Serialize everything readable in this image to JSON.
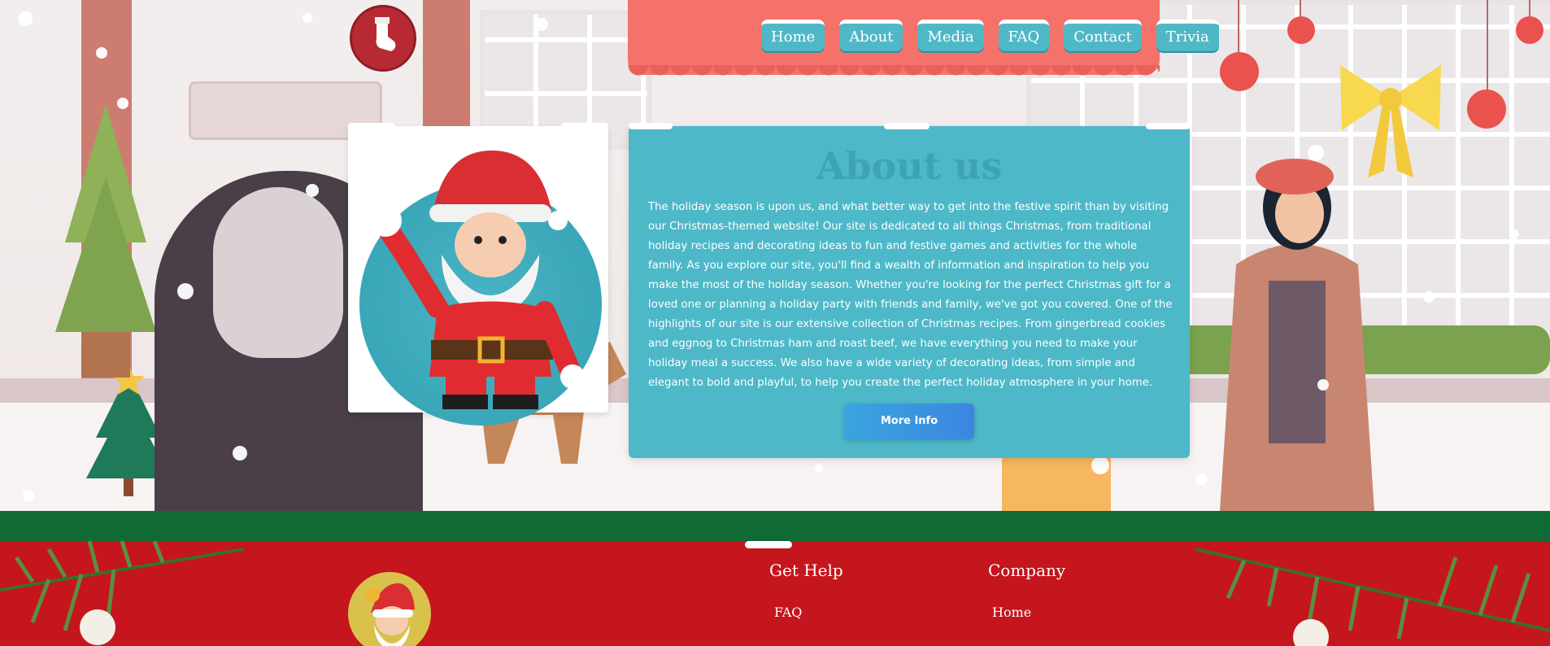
{
  "nav": {
    "items": [
      "Home",
      "About",
      "Media",
      "FAQ",
      "Contact",
      "Trivia"
    ]
  },
  "about": {
    "title": "About us",
    "body": "The holiday season is upon us, and what better way to get into the festive spirit than by visiting our Christmas-themed website! Our site is dedicated to all things Christmas, from traditional holiday recipes and decorating ideas to fun and festive games and activities for the whole family. As you explore our site, you'll find a wealth of information and inspiration to help you make the most of the holiday season. Whether you're looking for the perfect Christmas gift for a loved one or planning a holiday party with friends and family, we've got you covered. One of the highlights of our site is our extensive collection of Christmas recipes. From gingerbread cookies and eggnog to Christmas ham and roast beef, we have everything you need to make your holiday meal a success. We also have a wide variety of decorating ideas, from simple and elegant to bold and playful, to help you create the perfect holiday atmosphere in your home.",
    "button": "More Info"
  },
  "footer": {
    "get_help": {
      "heading": "Get Help",
      "links": [
        "FAQ"
      ]
    },
    "company": {
      "heading": "Company",
      "links": [
        "Home"
      ]
    }
  },
  "icons": {
    "stocking": "stocking-icon",
    "santa": "santa-illustration",
    "footer_logo": "santa-logo"
  },
  "colors": {
    "accent_teal": "#4db8c8",
    "button_blue": "#3a96df",
    "footer_red": "#c5151d",
    "footer_green": "#0f6a34",
    "awning_coral": "#f5726b"
  }
}
